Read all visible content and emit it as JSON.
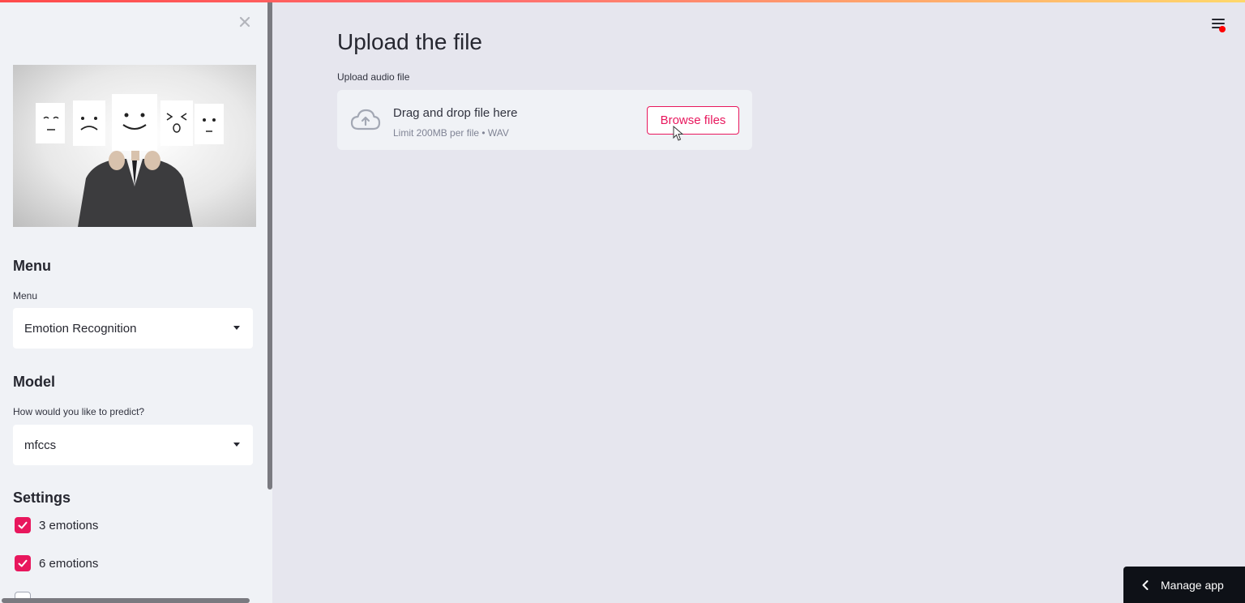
{
  "sidebar": {
    "close_icon": "close-icon",
    "menu_heading": "Menu",
    "menu_label": "Menu",
    "menu_value": "Emotion Recognition",
    "model_heading": "Model",
    "model_label": "How would you like to predict?",
    "model_value": "mfccs",
    "settings_heading": "Settings",
    "checkboxes": [
      {
        "label": "3 emotions",
        "checked": true
      },
      {
        "label": "6 emotions",
        "checked": true
      }
    ]
  },
  "main": {
    "title": "Upload the file",
    "upload_label": "Upload audio file",
    "dropzone_text": "Drag and drop file here",
    "dropzone_limit": "Limit 200MB per file • WAV",
    "browse_label": "Browse files"
  },
  "manage_app_label": "Manage app",
  "colors": {
    "accent": "#e8175d",
    "sidebar_bg": "#f0f2f6",
    "main_bg": "#e6e6ee",
    "manage_bg": "#0e1117"
  }
}
